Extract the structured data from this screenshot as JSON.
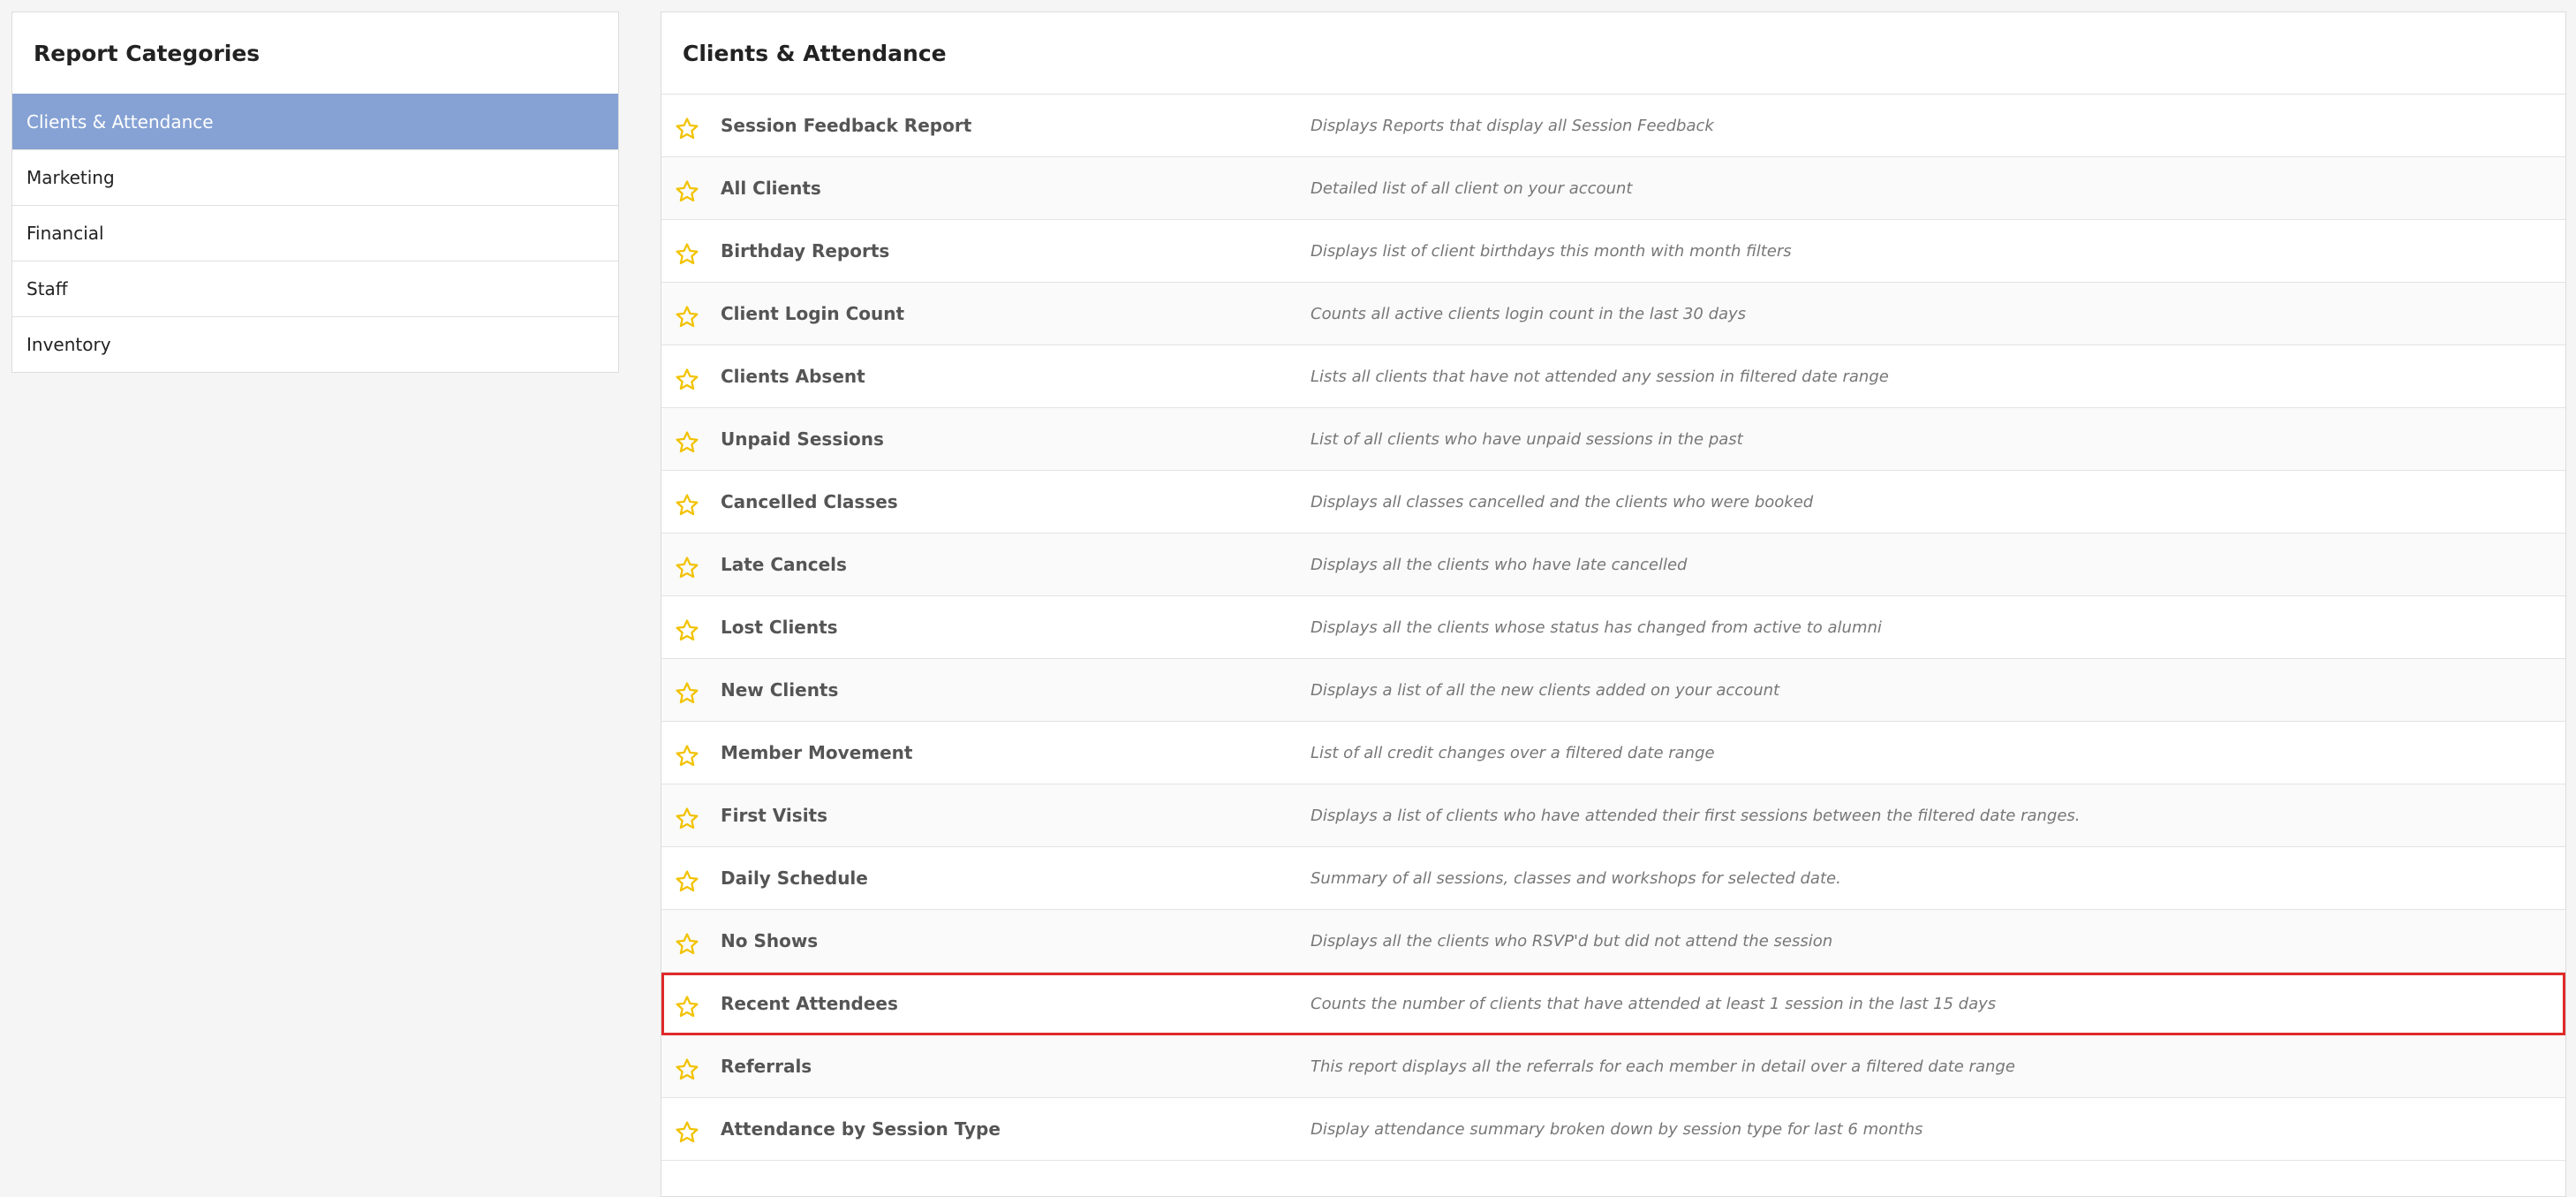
{
  "sidebar": {
    "title": "Report Categories",
    "items": [
      {
        "label": "Clients & Attendance",
        "active": true
      },
      {
        "label": "Marketing",
        "active": false
      },
      {
        "label": "Financial",
        "active": false
      },
      {
        "label": "Staff",
        "active": false
      },
      {
        "label": "Inventory",
        "active": false
      }
    ]
  },
  "main": {
    "title": "Clients & Attendance",
    "reports": [
      {
        "name": "Session Feedback Report",
        "description": "Displays Reports that display all Session Feedback"
      },
      {
        "name": "All Clients",
        "description": "Detailed list of all client on your account"
      },
      {
        "name": "Birthday Reports",
        "description": "Displays list of client birthdays this month with month filters"
      },
      {
        "name": "Client Login Count",
        "description": "Counts all active clients login count in the last 30 days"
      },
      {
        "name": "Clients Absent",
        "description": "Lists all clients that have not attended any session in filtered date range"
      },
      {
        "name": "Unpaid Sessions",
        "description": "List of all clients who have unpaid sessions in the past"
      },
      {
        "name": "Cancelled Classes",
        "description": "Displays all classes cancelled and the clients who were booked"
      },
      {
        "name": "Late Cancels",
        "description": "Displays all the clients who have late cancelled"
      },
      {
        "name": "Lost Clients",
        "description": "Displays all the clients whose status has changed from active to alumni"
      },
      {
        "name": "New Clients",
        "description": "Displays a list of all the new clients added on your account"
      },
      {
        "name": "Member Movement",
        "description": "List of all credit changes over a filtered date range"
      },
      {
        "name": "First Visits",
        "description": "Displays a list of clients who have attended their first sessions between the filtered date ranges."
      },
      {
        "name": "Daily Schedule",
        "description": "Summary of all sessions, classes and workshops for selected date."
      },
      {
        "name": "No Shows",
        "description": "Displays all the clients who RSVP'd but did not attend the session"
      },
      {
        "name": "Recent Attendees",
        "description": "Counts the number of clients that have attended at least 1 session in the last 15 days",
        "highlighted": true
      },
      {
        "name": "Referrals",
        "description": "This report displays all the referrals for each member in detail over a filtered date range"
      },
      {
        "name": "Attendance by Session Type",
        "description": "Display attendance summary broken down by session type for last 6 months"
      }
    ]
  },
  "colors": {
    "active_category_bg": "#86a2d4",
    "star": "#f2c200",
    "highlight_border": "#e02a2a"
  },
  "icons": {
    "favorite": "star-outline-icon"
  }
}
